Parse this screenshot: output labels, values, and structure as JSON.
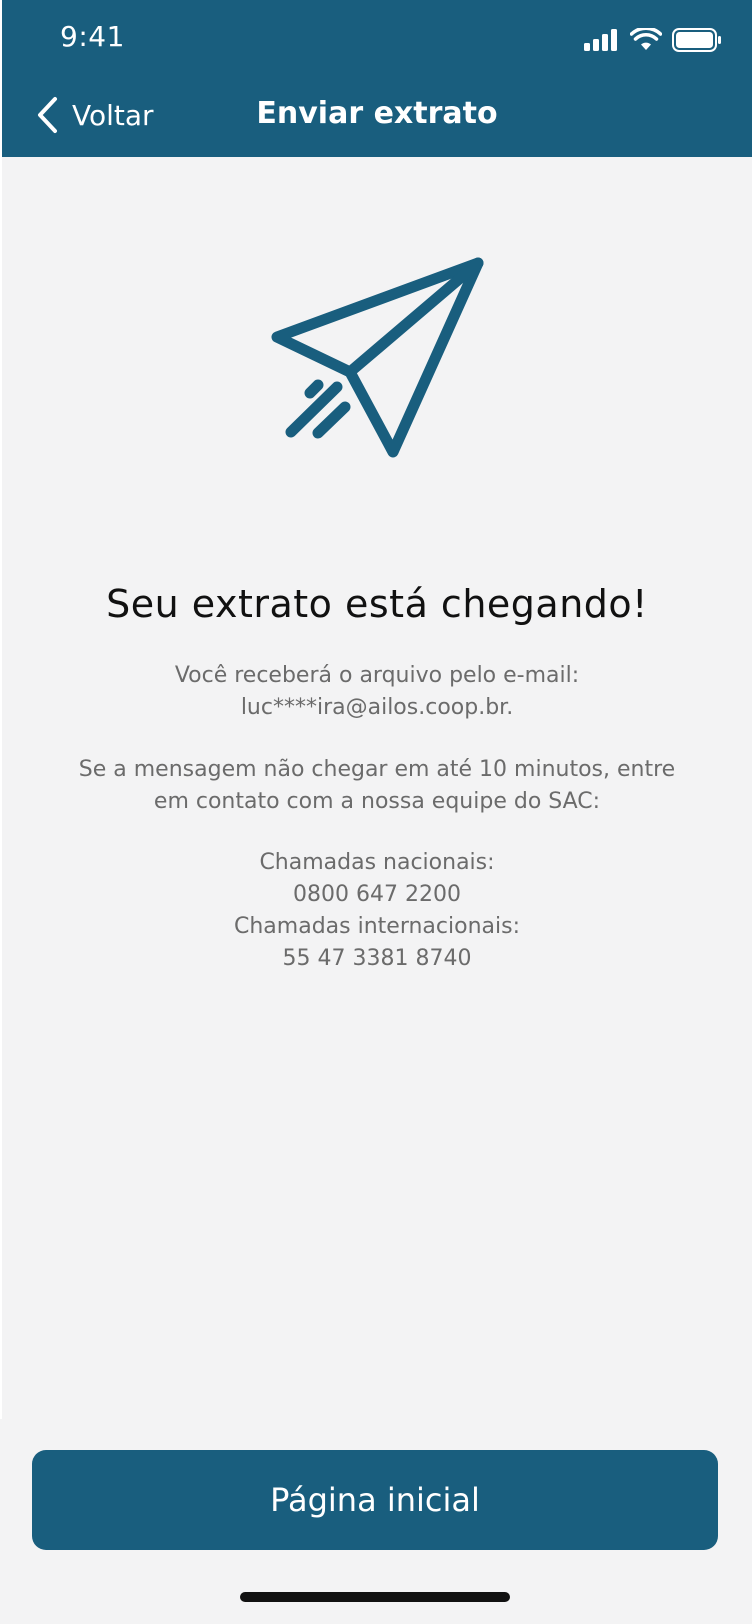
{
  "status_bar": {
    "time": "9:41",
    "icons": [
      "cellular-signal-icon",
      "wifi-icon",
      "battery-icon"
    ]
  },
  "header": {
    "back_label": "Voltar",
    "title": "Enviar extrato",
    "background_color": "#195e7e"
  },
  "main": {
    "illustration": "paper-plane-icon",
    "headline": "Seu extrato está chegando!",
    "email_intro": "Você receberá o arquivo pelo e-mail:",
    "email": "luc****ira@ailos.coop.br.",
    "delay_message": "Se a mensagem não chegar em até 10 minutos, entre em contato com a nossa equipe do SAC:",
    "national_label": "Chamadas nacionais:",
    "national_phone": "0800 647 2200",
    "international_label": "Chamadas internacionais:",
    "international_phone": "55 47 3381 8740"
  },
  "footer": {
    "button_label": "Página inicial"
  }
}
